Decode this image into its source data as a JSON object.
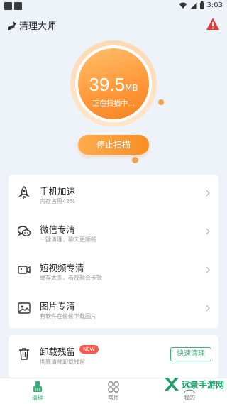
{
  "status_bar": {
    "time": "3:03"
  },
  "header": {
    "title": "清理大师"
  },
  "scan": {
    "size_value": "39.5",
    "size_unit": "MB",
    "status": "正在扫描中...",
    "stop_label": "停止扫描"
  },
  "features": [
    {
      "title": "手机加速",
      "subtitle": "内存占用42%",
      "icon": "rocket-icon"
    },
    {
      "title": "微信专清",
      "subtitle": "一键清理，聊天更顺畅",
      "icon": "wechat-icon"
    },
    {
      "title": "短视频专清",
      "subtitle": "缓存太多，看视频会卡顿",
      "icon": "video-icon"
    },
    {
      "title": "图片专清",
      "subtitle": "有软件在偷偷下载图片",
      "icon": "image-icon"
    }
  ],
  "uninstall": {
    "title": "卸载残留",
    "badge": "NEW",
    "subtitle": "彻底清除卸载残留",
    "button": "快速清理",
    "icon": "trash-icon"
  },
  "tabs": [
    {
      "label": "清理",
      "active": true
    },
    {
      "label": "常用",
      "active": false
    },
    {
      "label": "我的",
      "active": false
    }
  ],
  "watermark": {
    "text": "远景手游网"
  },
  "colors": {
    "accent": "#f88d23",
    "green": "#3bb27a",
    "background": "#eef3f9"
  }
}
